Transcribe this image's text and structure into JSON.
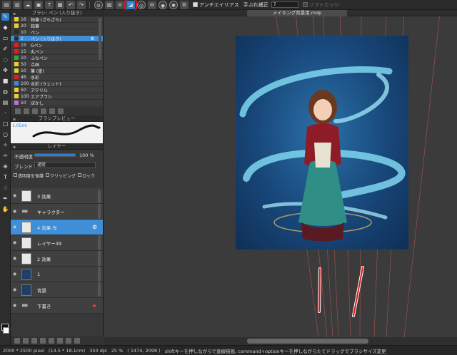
{
  "toolbar": {
    "antialias_label": "アンチエイリアス",
    "stabilization_label": "手ぶれ補正",
    "stabilization_value": "7",
    "soft_edge_label": "ソフトエッジ"
  },
  "document": {
    "tab_title": "メイキング背景用.mdp"
  },
  "brush_panel": {
    "title": "ブラシ: ペン (入り抜き)",
    "items": [
      {
        "size": "16",
        "name": "鉛筆 (ざらざら)",
        "color": "#e8d030"
      },
      {
        "size": "20",
        "name": "鉛筆",
        "color": "#e8d030"
      },
      {
        "size": "10",
        "name": "ペン",
        "color": "#2a2a2a"
      },
      {
        "size": "2",
        "name": "ペン (入り抜き)",
        "color": "#2a2a2a"
      },
      {
        "size": "15",
        "name": "Gペン",
        "color": "#e02020"
      },
      {
        "size": "15",
        "name": "丸ペン",
        "color": "#e02020"
      },
      {
        "size": "10",
        "name": "ふちペン",
        "color": "#3aa040"
      },
      {
        "size": "50",
        "name": "点画",
        "color": "#e8d030"
      },
      {
        "size": "50",
        "name": "筆 (墨)",
        "color": "#e8d030"
      },
      {
        "size": "46",
        "name": "水彩",
        "color": "#e02020"
      },
      {
        "size": "100",
        "name": "水彩 (ウェット)",
        "color": "#3a8ad8"
      },
      {
        "size": "50",
        "name": "アクリル",
        "color": "#e8d030"
      },
      {
        "size": "100",
        "name": "エアブラシ",
        "color": "#e8d030"
      },
      {
        "size": "50",
        "name": "ぼかし",
        "color": "#c070d0"
      }
    ]
  },
  "brush_preview": {
    "title": "ブラシプレビュー",
    "size_label": "1.05mi"
  },
  "layer_panel": {
    "title": "レイヤー",
    "opacity_label": "不透明度",
    "opacity_value": "100 %",
    "opacity": 1.0,
    "blend_label": "ブレンド",
    "blend_value": "通常",
    "protect_alpha": "透明度を保護",
    "clipping": "クリッピング",
    "lock": "ロック",
    "layers": [
      {
        "name": "3 効果",
        "thumb": "light",
        "selected": false
      },
      {
        "name": "キャラクター",
        "thumb": "folder",
        "selected": false
      },
      {
        "name": "4 効果 光",
        "thumb": "light",
        "selected": true
      },
      {
        "name": "レイヤー39",
        "thumb": "light",
        "selected": false
      },
      {
        "name": "2 効果",
        "thumb": "light",
        "selected": false
      },
      {
        "name": "1",
        "thumb": "dark",
        "selected": false
      },
      {
        "name": "背景",
        "thumb": "dark",
        "selected": false
      },
      {
        "name": "下書き",
        "thumb": "folder",
        "selected": false
      }
    ]
  },
  "status_bar": {
    "dimensions": "2000 * 2500 pixel",
    "size_cm": "(14.5 * 18.1cm)",
    "dpi": "350 dpi",
    "zoom": "25 %",
    "coordinates": "( 1474, 2098 )",
    "hint": "shiftキーを押しながらで直線描画, command+optionキーを押しながらたてドラッグでブラシサイズ変更"
  },
  "colors": {
    "accent": "#2a7fd0",
    "highlight_box": "#e01818",
    "annotation_stroke": "#e01818"
  }
}
